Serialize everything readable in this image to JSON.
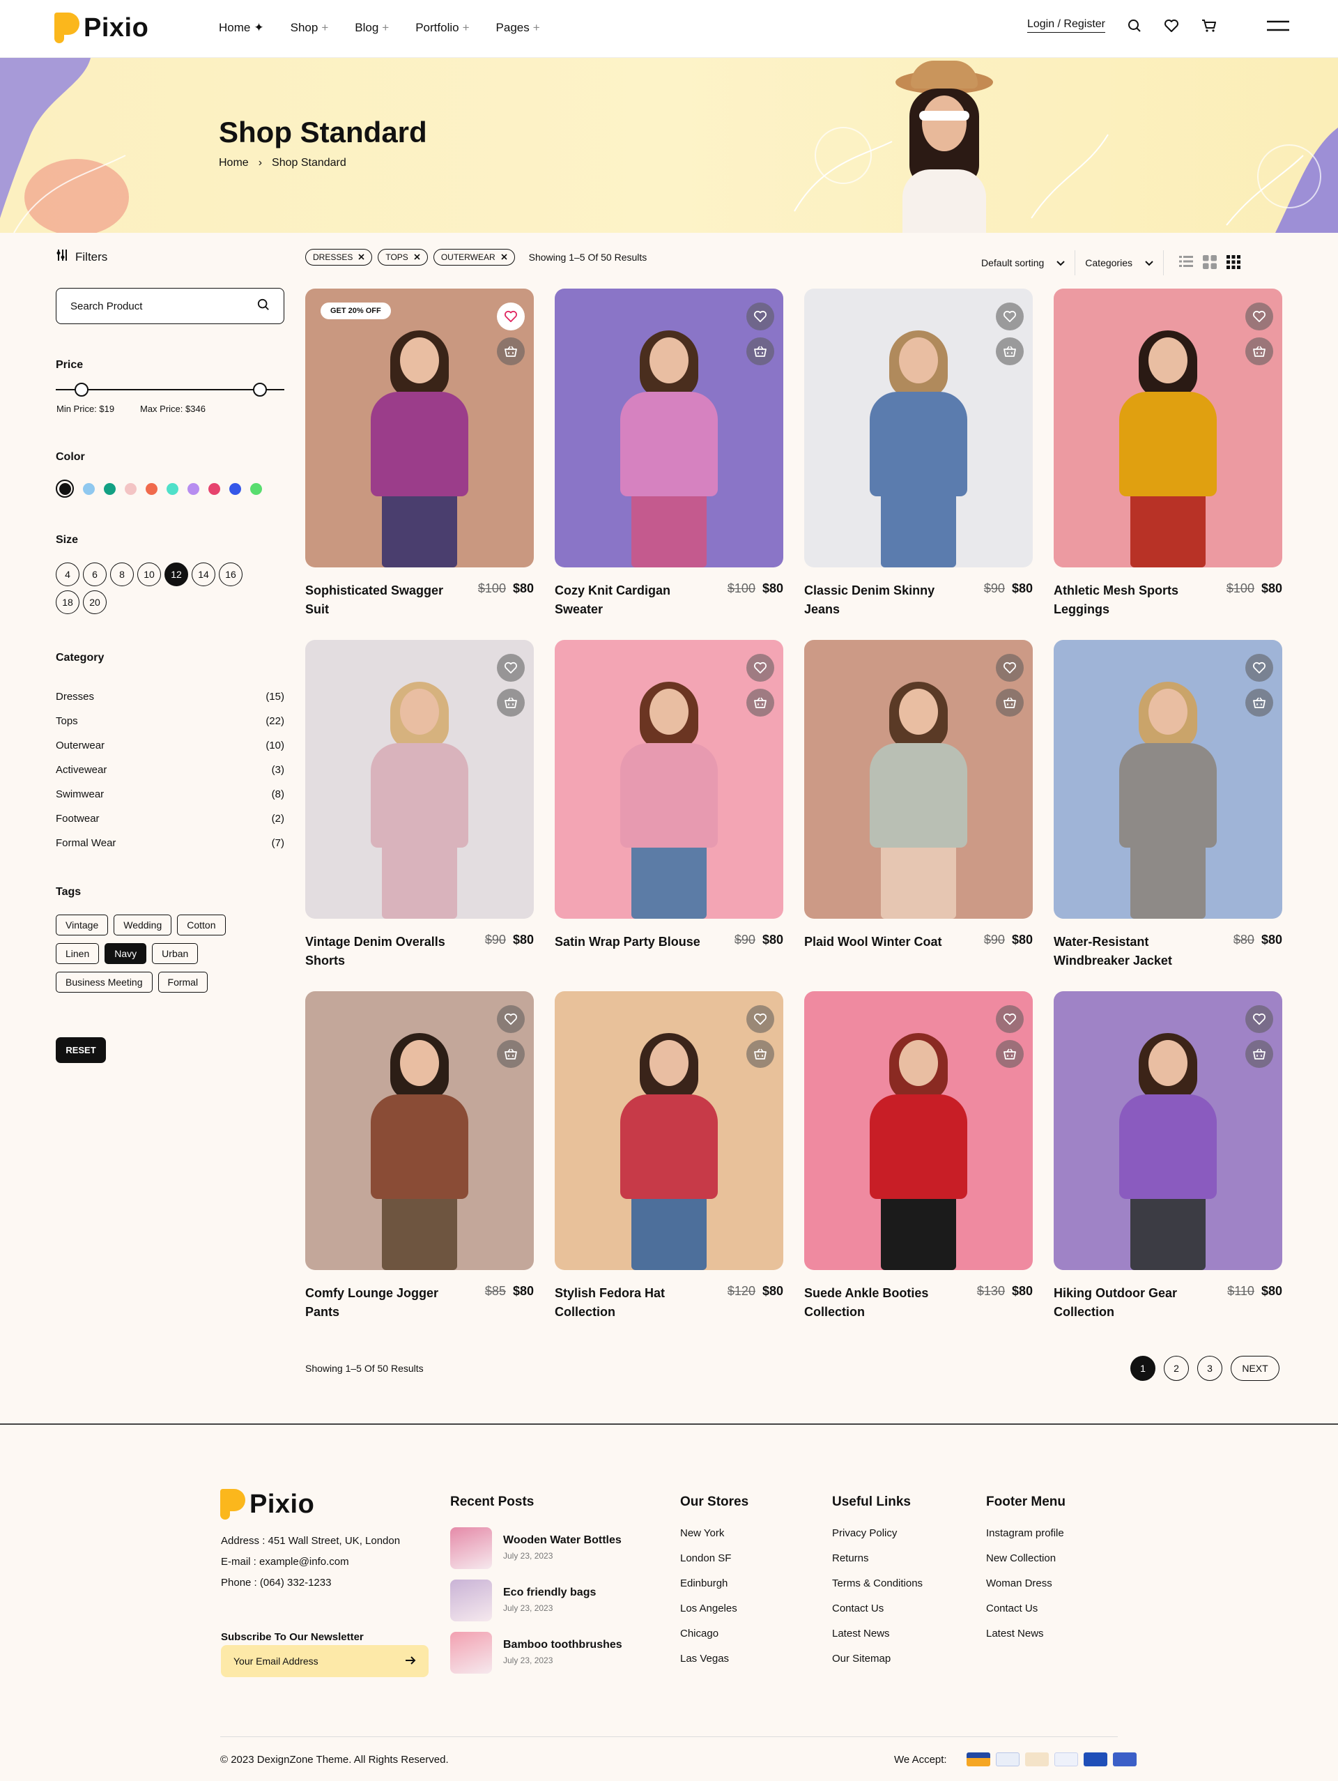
{
  "header": {
    "brand": "Pixio",
    "nav": [
      {
        "label": "Home",
        "mark": "✦"
      },
      {
        "label": "Shop",
        "mark": "+"
      },
      {
        "label": "Blog",
        "mark": "+"
      },
      {
        "label": "Portfolio",
        "mark": "+"
      },
      {
        "label": "Pages",
        "mark": "+"
      }
    ],
    "login": "Login / Register",
    "icons": [
      "search-icon",
      "heart-icon",
      "cart-icon",
      "menu-icon"
    ]
  },
  "hero": {
    "title": "Shop Standard",
    "breadcrumb": [
      "Home",
      "Shop Standard"
    ],
    "colors": {
      "bg": "#fcf0c0",
      "accent_left": "#a79ad8",
      "accent_right": "#9d8fd6"
    }
  },
  "sidebar": {
    "filters_label": "Filters",
    "search_placeholder": "Search Product",
    "price_label": "Price",
    "min_price": "Min Price: $19",
    "max_price": "Max Price: $346",
    "color_label": "Color",
    "colors": [
      "#111111",
      "#8fc8ef",
      "#12a083",
      "#f3c4c4",
      "#f06a4c",
      "#4fe0c9",
      "#b78df0",
      "#e6436d",
      "#3557e8",
      "#58dd6e"
    ],
    "size_label": "Size",
    "sizes": [
      "4",
      "6",
      "8",
      "10",
      "12",
      "14",
      "16",
      "18",
      "20"
    ],
    "selected_size": "12",
    "category_label": "Category",
    "categories": [
      {
        "name": "Dresses",
        "count": "(15)"
      },
      {
        "name": "Tops",
        "count": "(22)"
      },
      {
        "name": "Outerwear",
        "count": "(10)"
      },
      {
        "name": "Activewear",
        "count": "(3)"
      },
      {
        "name": "Swimwear",
        "count": "(8)"
      },
      {
        "name": "Footwear",
        "count": "(2)"
      },
      {
        "name": "Formal Wear",
        "count": "(7)"
      }
    ],
    "tags_label": "Tags",
    "tags": [
      "Vintage",
      "Wedding",
      "Cotton",
      "Linen",
      "Navy",
      "Urban",
      "Business Meeting",
      "Formal"
    ],
    "selected_tag": "Navy",
    "reset": "RESET"
  },
  "toolbar": {
    "chips": [
      "DRESSES",
      "TOPS",
      "OUTERWEAR"
    ],
    "results": "Showing 1–5 Of 50 Results",
    "sort": "Default sorting",
    "categories": "Categories"
  },
  "products": [
    {
      "name": "Sophisticated Swagger Suit",
      "old": "$100",
      "price": "$80",
      "bg": "#c99880",
      "top": "#9b3d8a",
      "bottom": "#4a3e6e",
      "hair": "#3a2418",
      "badge": "GET 20% OFF",
      "liked": true
    },
    {
      "name": "Cozy Knit Cardigan Sweater",
      "old": "$100",
      "price": "$80",
      "bg": "#8a75c7",
      "top": "#d682c0",
      "bottom": "#c45a8e",
      "hair": "#4a2e1e"
    },
    {
      "name": "Classic Denim Skinny Jeans",
      "old": "$90",
      "price": "$80",
      "bg": "#e9e9ec",
      "top": "#5b7cae",
      "bottom": "#5b7cae",
      "hair": "#b08a5c"
    },
    {
      "name": "Athletic Mesh Sports Leggings",
      "old": "$100",
      "price": "$80",
      "bg": "#ec9aa1",
      "top": "#e0a010",
      "bottom": "#b83226",
      "hair": "#2a1a14"
    },
    {
      "name": "Vintage Denim Overalls Shorts",
      "old": "$90",
      "price": "$80",
      "bg": "#e3dde0",
      "top": "#d9b3bc",
      "bottom": "#d9b3bc",
      "hair": "#d6b27e"
    },
    {
      "name": "Satin Wrap Party Blouse",
      "old": "$90",
      "price": "$80",
      "bg": "#f3a5b4",
      "top": "#e79ab0",
      "bottom": "#5c7ca6",
      "hair": "#6b3522"
    },
    {
      "name": "Plaid Wool Winter Coat",
      "old": "$90",
      "price": "$80",
      "bg": "#cc9a86",
      "top": "#b9bfb4",
      "bottom": "#e6c6b2",
      "hair": "#5a3a26"
    },
    {
      "name": "Water-Resistant Windbreaker Jacket",
      "old": "$80",
      "price": "$80",
      "bg": "#9fb4d7",
      "top": "#8e8a87",
      "bottom": "#8e8a87",
      "hair": "#caa46a"
    },
    {
      "name": "Comfy Lounge Jogger Pants",
      "old": "$85",
      "price": "$80",
      "bg": "#c3a79a",
      "top": "#8a4c36",
      "bottom": "#6e5540",
      "hair": "#2c1e16"
    },
    {
      "name": "Stylish Fedora Hat Collection",
      "old": "$120",
      "price": "$80",
      "bg": "#e8c19a",
      "top": "#c73a48",
      "bottom": "#4d6f9b",
      "hair": "#3a241a"
    },
    {
      "name": "Suede Ankle Booties Collection",
      "old": "$130",
      "price": "$80",
      "bg": "#ef8aa0",
      "top": "#c81e26",
      "bottom": "#1b1b1b",
      "hair": "#8a2a22"
    },
    {
      "name": "Hiking Outdoor Gear Collection",
      "old": "$110",
      "price": "$80",
      "bg": "#9f83c6",
      "top": "#8a5bbf",
      "bottom": "#3c3c44",
      "hair": "#3c2418"
    }
  ],
  "pagination": {
    "results": "Showing 1–5 Of 50 Results",
    "pages": [
      "1",
      "2",
      "3"
    ],
    "current": "1",
    "next": "NEXT"
  },
  "footer": {
    "brand": "Pixio",
    "address": "Address : 451 Wall Street, UK, London",
    "email": "E-mail : example@info.com",
    "phone": "Phone : (064) 332-1233",
    "newsletter_title": "Subscribe To Our Newsletter",
    "newsletter_placeholder": "Your Email Address",
    "recent_title": "Recent Posts",
    "posts": [
      {
        "title": "Wooden Water Bottles",
        "date": "July 23, 2023",
        "color": "#e58aa8"
      },
      {
        "title": "Eco friendly bags",
        "date": "July 23, 2023",
        "color": "#c9b3d6"
      },
      {
        "title": "Bamboo toothbrushes",
        "date": "July 23, 2023",
        "color": "#f2a0b0"
      }
    ],
    "stores_title": "Our Stores",
    "stores": [
      "New York",
      "London SF",
      "Edinburgh",
      "Los Angeles",
      "Chicago",
      "Las Vegas"
    ],
    "links_title": "Useful Links",
    "links": [
      "Privacy Policy",
      "Returns",
      "Terms & Conditions",
      "Contact Us",
      "Latest News",
      "Our Sitemap"
    ],
    "menu_title": "Footer Menu",
    "menu": [
      "Instagram profile",
      "New Collection",
      "Woman Dress",
      "Contact Us",
      "Latest News"
    ],
    "copyright": "© 2023 DexignZone Theme. All Rights Reserved.",
    "we_accept": "We Accept:",
    "payment_icons": [
      "visa-icon",
      "paypal-icon",
      "mastercard-icon",
      "diners-icon",
      "amex-icon",
      "maestro-icon"
    ]
  }
}
